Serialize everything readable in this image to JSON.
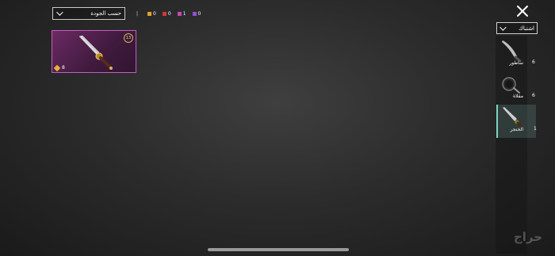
{
  "sort": {
    "label": "حسب الجودة"
  },
  "quality_filters": {
    "separator": "|",
    "items": [
      {
        "color": "#e0a32a",
        "count": "0"
      },
      {
        "color": "#d13a3a",
        "count": "0"
      },
      {
        "color": "#c049b3",
        "count": "1"
      },
      {
        "color": "#8a52d6",
        "count": "0"
      }
    ]
  },
  "inventory": [
    {
      "icon": "dagger-icon",
      "level": "13",
      "quantity": "8",
      "rarity_color": "#c25fc2"
    }
  ],
  "category": {
    "label": "اشتباك"
  },
  "sidebar": {
    "items": [
      {
        "label": "ساطور",
        "count": "6",
        "icon": "machete-icon"
      },
      {
        "label": "مقلاة",
        "count": "6",
        "icon": "pan-icon"
      },
      {
        "label": "الخنجر",
        "count": "1",
        "icon": "dagger-icon",
        "selected": true
      }
    ]
  },
  "watermark": "حراج"
}
